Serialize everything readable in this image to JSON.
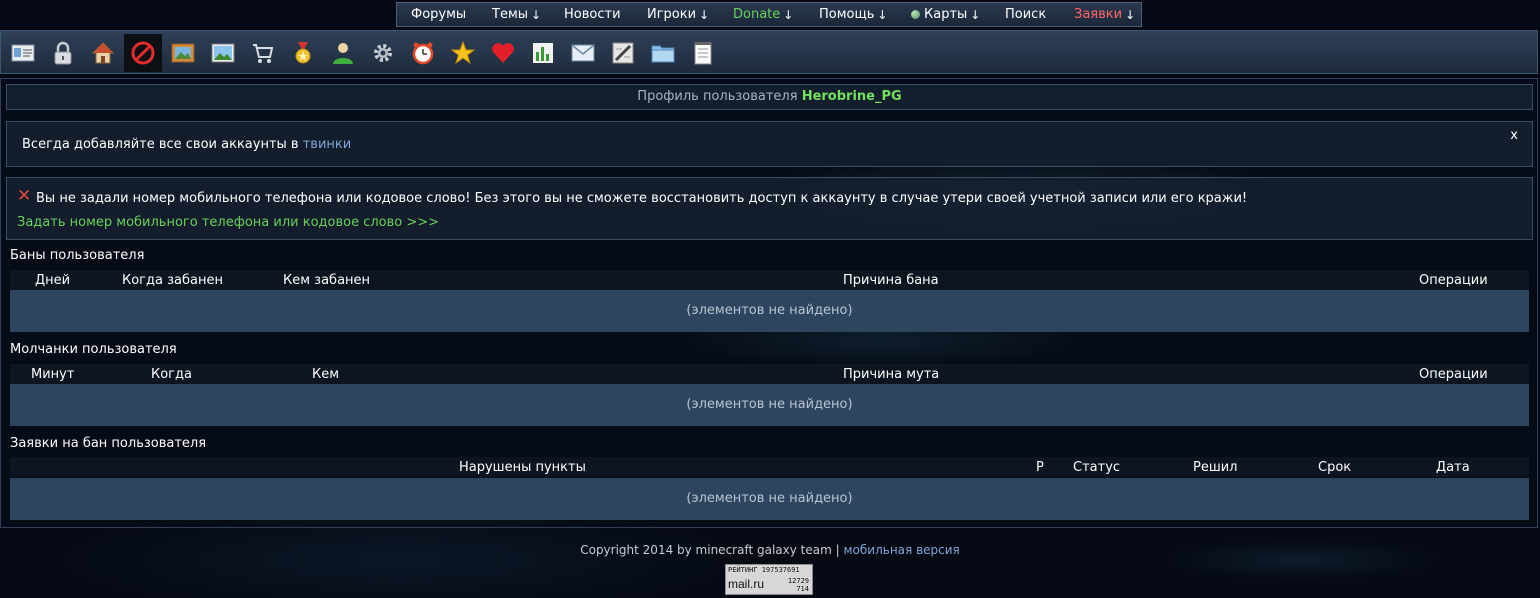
{
  "topnav": {
    "forums": "Форумы",
    "topics": "Темы",
    "news": "Новости",
    "players": "Игроки",
    "donate": "Donate",
    "help": "Помощь",
    "maps": "Карты",
    "search": "Поиск",
    "requests": "Заявки",
    "arrow": "↓"
  },
  "toolbar": {
    "icons": [
      "profile-card",
      "lock",
      "home",
      "ban",
      "picture-frame",
      "landscape",
      "cart",
      "medal",
      "user",
      "gear",
      "alarm-clock",
      "star",
      "heart",
      "bar-chart",
      "mail",
      "pencil-edit",
      "folder",
      "notepad"
    ]
  },
  "profile": {
    "prefix": "Профиль пользователя",
    "username": "Herobrine_PG"
  },
  "notice": {
    "text": "Всегда добавляйте все свои аккаунты в",
    "link": "твинки",
    "close": "x"
  },
  "warning": {
    "message": "Вы не задали номер мобильного телефона или кодовое слово! Без этого вы не сможете восстановить доступ к аккаунту в случае утери своей учетной записи или его кражи!",
    "link": "Задать номер мобильного телефона или кодовое слово >>>"
  },
  "bans": {
    "title": "Баны пользователя",
    "headers": [
      "Дней",
      "Когда забанен",
      "Кем забанен",
      "Причина бана",
      "Операции"
    ],
    "empty": "(элементов не найдено)"
  },
  "mutes": {
    "title": "Молчанки пользователя",
    "headers": [
      "Минут",
      "Когда",
      "Кем",
      "Причина мута",
      "Операции"
    ],
    "empty": "(элементов не найдено)"
  },
  "requests": {
    "title": "Заявки на бан пользователя",
    "headers": [
      "Нарушены пункты",
      "Р",
      "Статус",
      "Решил",
      "Срок",
      "Дата"
    ],
    "empty": "(элементов не найдено)"
  },
  "footer": {
    "copyright": "Copyright 2014 by minecraft galaxy team",
    "separator": "|",
    "mobile": "мобильная версия"
  },
  "counter": {
    "label": "РЕЙТИНГ 197537691",
    "brand": "mail.ru",
    "n1": "12729",
    "n2": "714"
  },
  "colors": {
    "accent_green": "#69d15a",
    "accent_red": "#ff6666",
    "link_blue": "#7fa6d6"
  }
}
